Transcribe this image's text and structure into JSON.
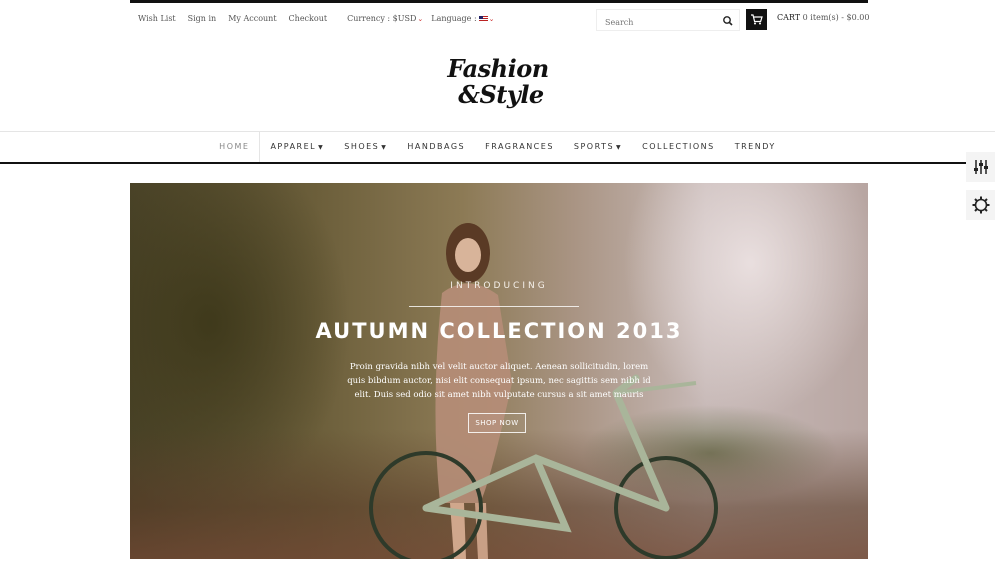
{
  "topbar": {
    "links": [
      "Wish List",
      "Sign in",
      "My Account",
      "Checkout"
    ],
    "currency_label": "Currency : $USD",
    "language_label": "Language :",
    "search_placeholder": "Search",
    "cart_label": "CART",
    "cart_summary": "0 item(s) - $0.00"
  },
  "logo": {
    "line1": "Fashion",
    "line2": "&Style"
  },
  "nav": {
    "items": [
      "HOME",
      "APPAREL",
      "SHOES",
      "HANDBAGS",
      "FRAGRANCES",
      "SPORTS",
      "COLLECTIONS",
      "TRENDY"
    ]
  },
  "hero": {
    "kicker": "INTRODUCING",
    "title": "AUTUMN COLLECTION 2013",
    "description": "Proin gravida nibh vel velit auctor aliquet. Aenean sollicitudin, lorem quis bibdum auctor, nisi elit consequat ipsum, nec sagittis sem nibh id elit. Duis sed odio sit amet nibh vulputate cursus a sit amet mauris",
    "button": "SHOP NOW"
  },
  "side_tools": {
    "icons": [
      "sliders-icon",
      "gear-icon"
    ]
  },
  "colors": {
    "accent": "#111111",
    "caret": "#cc3333",
    "nav_rule": "#111111"
  }
}
